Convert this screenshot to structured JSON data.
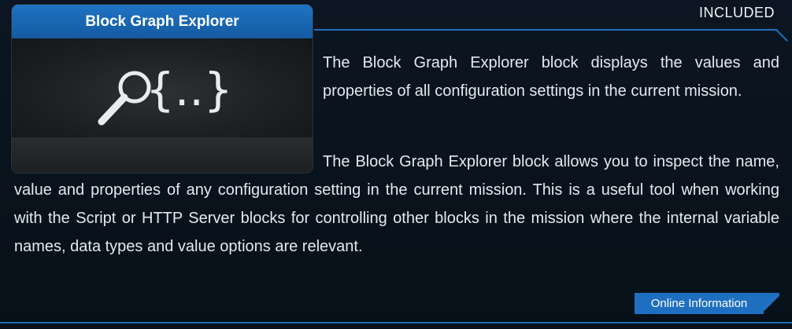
{
  "badge": {
    "text": "INCLUDED"
  },
  "card": {
    "title": "Block Graph Explorer",
    "icon": "magnifier-braces-icon"
  },
  "description": {
    "summary": "The Block Graph Explorer block displays the values and properties of all configuration settings in the current mission.",
    "details": "The Block Graph Explorer block allows you to inspect the name, value and properties of any configuration setting in the current mission. This is a useful tool when working with the Script or HTTP Server blocks for controlling other blocks in the mission where the internal variable names, data types and value options are relevant."
  },
  "actions": {
    "online_info": "Online Information"
  },
  "colors": {
    "accent": "#1f6fc0",
    "background": "#0b1622"
  }
}
